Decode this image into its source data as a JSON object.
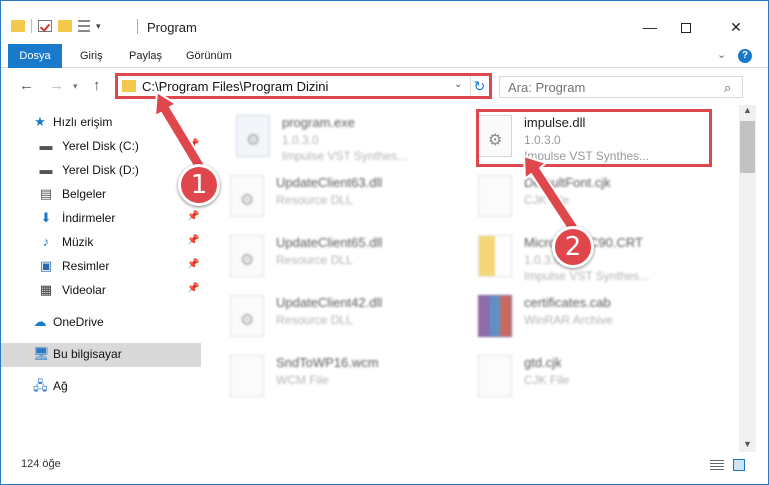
{
  "window": {
    "title": "Program",
    "controls": {
      "minimize": "—",
      "close": "✕"
    }
  },
  "ribbon": {
    "tabs": [
      "Dosya",
      "Giriş",
      "Paylaş",
      "Görünüm"
    ],
    "help": "?"
  },
  "address": {
    "path": "C:\\Program Files\\Program Dizini"
  },
  "search": {
    "placeholder": "Ara: Program"
  },
  "sidebar": {
    "quick_access": "Hızlı erişim",
    "items": [
      {
        "label": "Yerel Disk (C:)",
        "icon": "drive-icon",
        "pinned": true
      },
      {
        "label": "Yerel Disk (D:)",
        "icon": "drive-icon",
        "pinned": false
      },
      {
        "label": "Belgeler",
        "icon": "documents-icon",
        "pinned": true
      },
      {
        "label": "İndirmeler",
        "icon": "downloads-icon",
        "pinned": true
      },
      {
        "label": "Müzik",
        "icon": "music-icon",
        "pinned": true
      },
      {
        "label": "Resimler",
        "icon": "pictures-icon",
        "pinned": true
      },
      {
        "label": "Videolar",
        "icon": "videos-icon",
        "pinned": true
      }
    ],
    "onedrive": "OneDrive",
    "this_pc": "Bu bilgisayar",
    "network": "Ağ"
  },
  "files": [
    {
      "name": "program.exe",
      "line2": "1.0.3.0",
      "line3": "Impulse VST Synthes...",
      "icon": "exe-icon",
      "blurred": true
    },
    {
      "name": "impulse.dll",
      "line2": "1.0.3.0",
      "line3": "Impulse VST Synthes...",
      "icon": "dll-gear-icon",
      "blurred": false
    },
    {
      "name": "UpdateClient63.dll",
      "line2": "Resource DLL",
      "line3": "",
      "icon": "dll-gear-icon",
      "blurred": true
    },
    {
      "name": "DefaultFont.cjk",
      "line2": "CJK File",
      "line3": "",
      "icon": "file-icon",
      "blurred": true
    },
    {
      "name": "UpdateClient65.dll",
      "line2": "Resource DLL",
      "line3": "",
      "icon": "dll-gear-icon",
      "blurred": true
    },
    {
      "name": "Microsoft.VC90.CRT",
      "line2": "1.0.3.0",
      "line3": "Impulse VST Synthes...",
      "icon": "zip-folder-icon",
      "blurred": true
    },
    {
      "name": "UpdateClient42.dll",
      "line2": "Resource DLL",
      "line3": "",
      "icon": "dll-gear-icon",
      "blurred": true
    },
    {
      "name": "certificates.cab",
      "line2": "WinRAR Archive",
      "line3": "",
      "icon": "winrar-icon",
      "blurred": true
    },
    {
      "name": "SndToWP16.wcm",
      "line2": "WCM File",
      "line3": "",
      "icon": "file-icon",
      "blurred": true
    },
    {
      "name": "gtd.cjk",
      "line2": "CJK File",
      "line3": "",
      "icon": "file-icon",
      "blurred": true
    }
  ],
  "status": {
    "count": "124 öğe"
  },
  "annotations": {
    "badge1": "1",
    "badge2": "2",
    "color": "#e0474c"
  }
}
